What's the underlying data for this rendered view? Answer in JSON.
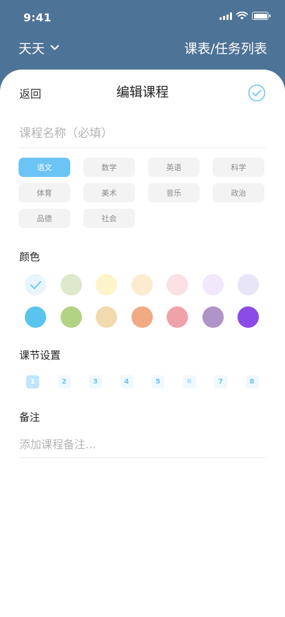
{
  "status_bar": {
    "time": "9:41"
  },
  "nav": {
    "user": "天天",
    "right_label": "课表/任务列表"
  },
  "sheet": {
    "back_label": "返回",
    "title": "编辑课程",
    "name_placeholder": "课程名称（必填）"
  },
  "subjects": {
    "items": [
      "语文",
      "数学",
      "英语",
      "科学",
      "体育",
      "美术",
      "音乐",
      "政治",
      "品德",
      "社会"
    ],
    "selected": "语文"
  },
  "colors": {
    "label": "颜色",
    "selected_index": 0,
    "swatches": [
      "#e9f5fc",
      "#dde9ca",
      "#fdf5c9",
      "#fbecd0",
      "#f9e1e5",
      "#f2e8fb",
      "#e9e5f8",
      "#5ac4ee",
      "#b3d384",
      "#f3d9ae",
      "#f1aa82",
      "#f0a2aa",
      "#af94c8",
      "#8a4be6"
    ],
    "check_color": "#6cc4f4"
  },
  "periods": {
    "label": "课节设置",
    "items": [
      "1",
      "2",
      "3",
      "4",
      "5",
      "6",
      "7",
      "8"
    ],
    "selected": "1",
    "dim": [
      "6"
    ]
  },
  "note": {
    "label": "备注",
    "placeholder": "添加课程备注..."
  },
  "theme": {
    "header_bg": "#4d7396",
    "accent": "#6cc4f4"
  }
}
